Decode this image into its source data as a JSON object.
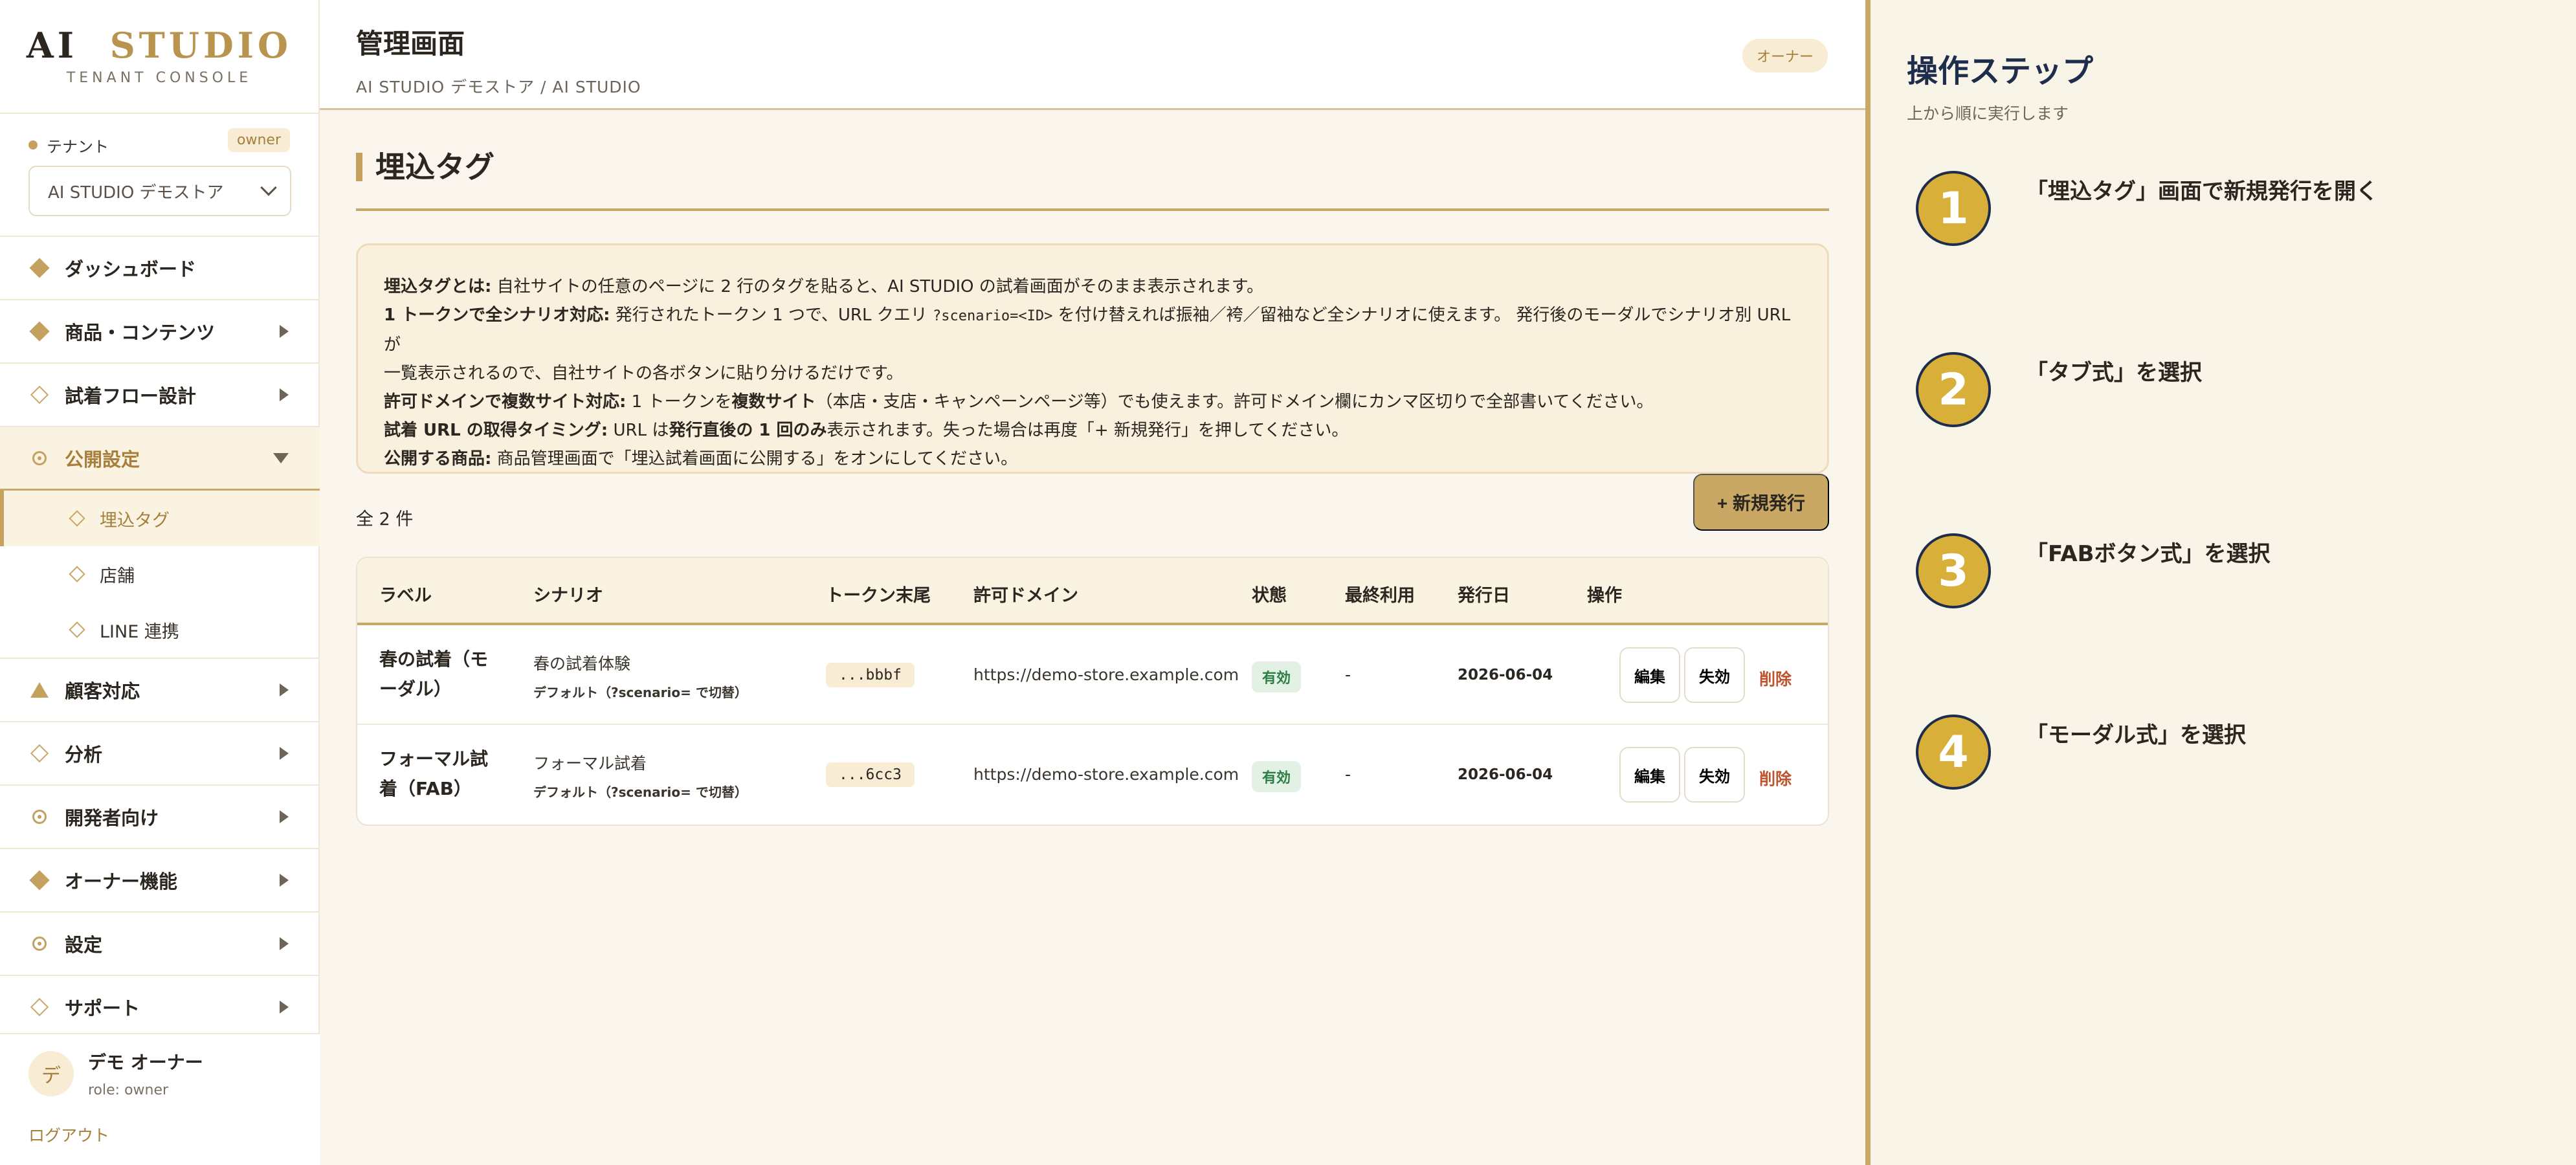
{
  "brand": {
    "logo_ai": "AI",
    "logo_studio": "STUDIO",
    "subtitle": "TENANT CONSOLE"
  },
  "tenant": {
    "label": "テナント",
    "badge": "owner",
    "selected": "AI STUDIO デモストア"
  },
  "nav": {
    "items": [
      {
        "label": "ダッシュボード",
        "icon": "diamond-filled"
      },
      {
        "label": "商品・コンテンツ",
        "icon": "diamond-filled"
      },
      {
        "label": "試着フロー設計",
        "icon": "diamond-outline"
      },
      {
        "label": "公開設定",
        "icon": "circle-outline"
      },
      {
        "label": "顧客対応",
        "icon": "triangle"
      },
      {
        "label": "分析",
        "icon": "diamond-outline"
      },
      {
        "label": "開発者向け",
        "icon": "circle-outline"
      },
      {
        "label": "オーナー機能",
        "icon": "diamond-filled"
      },
      {
        "label": "設定",
        "icon": "circle-outline"
      },
      {
        "label": "サポート",
        "icon": "diamond-outline"
      }
    ],
    "sub_items": [
      {
        "label": "埋込タグ"
      },
      {
        "label": "店舗"
      },
      {
        "label": "LINE 連携"
      }
    ]
  },
  "user": {
    "avatar": "デ",
    "name": "デモ オーナー",
    "role": "role: owner",
    "logout": "ログアウト"
  },
  "topbar": {
    "title": "管理画面",
    "breadcrumb": "AI STUDIO デモストア / AI STUDIO",
    "role_pill": "オーナー"
  },
  "page": {
    "title": "埋込タグ",
    "info": {
      "l1_bold": "埋込タグとは:",
      "l1": " 自社サイトの任意のページに 2 行のタグを貼ると、AI STUDIO の試着画面がそのまま表示されます。",
      "l2_bold": "1 トークンで全シナリオ対応:",
      "l2a": " 発行されたトークン 1 つで、URL クエリ ",
      "l2_code": "?scenario=<ID>",
      "l2b": " を付け替えれば振袖／袴／留袖など全シナリオに使えます。 発行後のモーダルでシナリオ別 URL が",
      "l3": "一覧表示されるので、自社サイトの各ボタンに貼り分けるだけです。",
      "l4_bold": "許可ドメインで複数サイト対応:",
      "l4a": " 1 トークンを",
      "l4_bold2": "複数サイト",
      "l4b": "（本店・支店・キャンペーンページ等）でも使えます。許可ドメイン欄にカンマ区切りで全部書いてください。",
      "l5_bold": "試着 URL の取得タイミング:",
      "l5a": " URL は",
      "l5_bold2": "発行直後の 1 回のみ",
      "l5b": "表示されます。失った場合は再度「+ 新規発行」を押してください。",
      "l6_bold": "公開する商品:",
      "l6": " 商品管理画面で「埋込試着画面に公開する」をオンにしてください。"
    },
    "count": "全 2 件",
    "new_button": "+ 新規発行"
  },
  "table": {
    "headers": [
      "ラベル",
      "シナリオ",
      "トークン末尾",
      "許可ドメイン",
      "状態",
      "最終利用",
      "発行日",
      "操作"
    ],
    "rows": [
      {
        "label": "春の試着（モーダル）",
        "scenario": "春の試着体験",
        "scenario_sub": "デフォルト（?scenario= で切替）",
        "token": "...bbbf",
        "domain": "https://demo-store.example.com",
        "status": "有効",
        "last_used": "-",
        "issued": "2026-06-04",
        "edit": "編集",
        "disable": "失効",
        "delete": "削除"
      },
      {
        "label": "フォーマル試着（FAB）",
        "scenario": "フォーマル試着",
        "scenario_sub": "デフォルト（?scenario= で切替）",
        "token": "...6cc3",
        "domain": "https://demo-store.example.com",
        "status": "有効",
        "last_used": "-",
        "issued": "2026-06-04",
        "edit": "編集",
        "disable": "失効",
        "delete": "削除"
      }
    ]
  },
  "steps": {
    "title": "操作ステップ",
    "subtitle": "上から順に実行します",
    "items": [
      {
        "num": "1",
        "text": "「埋込タグ」画面で新規発行を開く"
      },
      {
        "num": "2",
        "text": "「タブ式」を選択"
      },
      {
        "num": "3",
        "text": "「FABボタン式」を選択"
      },
      {
        "num": "4",
        "text": "「モーダル式」を選択"
      }
    ]
  },
  "colors": {
    "accent": "#c4a15f",
    "accent_dark": "#a67f3c",
    "navy": "#1f2d4d",
    "step_badge": "#d8b039",
    "status_ok": "#2e7d44",
    "danger": "#c0542f"
  }
}
